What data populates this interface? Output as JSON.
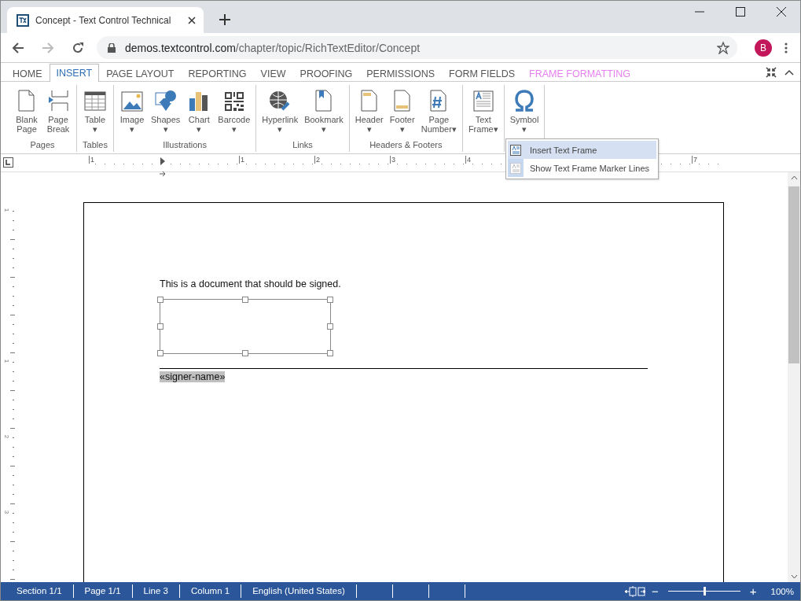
{
  "browser": {
    "tab_title": "Concept - Text Control Technical",
    "url_host": "demos.textcontrol.com",
    "url_path": "/chapter/topic/RichTextEditor/Concept",
    "profile_initial": "B"
  },
  "ribbon_tabs": [
    {
      "label": "HOME",
      "selected": false,
      "kind": "standard"
    },
    {
      "label": "INSERT",
      "selected": true,
      "kind": "standard"
    },
    {
      "label": "PAGE LAYOUT",
      "selected": false,
      "kind": "standard"
    },
    {
      "label": "REPORTING",
      "selected": false,
      "kind": "standard"
    },
    {
      "label": "VIEW",
      "selected": false,
      "kind": "standard"
    },
    {
      "label": "PROOFING",
      "selected": false,
      "kind": "standard"
    },
    {
      "label": "PERMISSIONS",
      "selected": false,
      "kind": "standard"
    },
    {
      "label": "FORM FIELDS",
      "selected": false,
      "kind": "standard"
    },
    {
      "label": "FRAME FORMATTING",
      "selected": false,
      "kind": "contextual"
    }
  ],
  "ribbon_groups": [
    {
      "label": "Pages",
      "buttons": [
        {
          "kind": "blank-page",
          "lines": [
            "Blank",
            "Page"
          ]
        },
        {
          "kind": "page-break",
          "lines": [
            "Page",
            "Break"
          ]
        }
      ]
    },
    {
      "label": "Tables",
      "buttons": [
        {
          "kind": "table",
          "lines": [
            "Table",
            "▾"
          ]
        }
      ]
    },
    {
      "label": "Illustrations",
      "buttons": [
        {
          "kind": "image",
          "lines": [
            "Image",
            "▾"
          ]
        },
        {
          "kind": "shapes",
          "lines": [
            "Shapes",
            "▾"
          ]
        },
        {
          "kind": "chart",
          "lines": [
            "Chart",
            "▾"
          ]
        },
        {
          "kind": "barcode",
          "lines": [
            "Barcode",
            "▾"
          ]
        }
      ]
    },
    {
      "label": "Links",
      "buttons": [
        {
          "kind": "hyperlink",
          "lines": [
            "Hyperlink",
            "▾"
          ]
        },
        {
          "kind": "bookmark",
          "lines": [
            "Bookmark",
            "▾"
          ]
        }
      ]
    },
    {
      "label": "Headers & Footers",
      "buttons": [
        {
          "kind": "header",
          "lines": [
            "Header",
            "▾"
          ]
        },
        {
          "kind": "footer",
          "lines": [
            "Footer",
            "▾"
          ]
        },
        {
          "kind": "page-number",
          "lines": [
            "Page",
            "Number▾"
          ]
        }
      ]
    },
    {
      "buttons": [
        {
          "kind": "text-frame",
          "lines": [
            "Text",
            "Frame▾"
          ]
        }
      ]
    },
    {
      "buttons": [
        {
          "kind": "symbol",
          "lines": [
            "Symbol",
            "▾"
          ]
        }
      ]
    }
  ],
  "dropdown_menu": [
    {
      "label": "Insert Text Frame",
      "selected": true
    },
    {
      "label": "Show Text Frame Marker Lines",
      "selected": false
    }
  ],
  "ruler": {
    "labels": [
      "1",
      "1",
      "2",
      "3",
      "4",
      "7"
    ]
  },
  "vertical_ruler": {
    "labels": [
      "1",
      "1",
      "2",
      "3"
    ]
  },
  "document": {
    "paragraph": "This is a document that should be signed.",
    "text_frame": {
      "selected": true
    },
    "merge_field": "«signer-name»"
  },
  "status_bar": {
    "items": [
      "Section 1/1",
      "Page 1/1",
      "Line 3",
      "Column 1",
      "English (United States)"
    ],
    "zoom": {
      "minus": "−",
      "plus": "+",
      "level": 0.5,
      "value": "100%"
    }
  }
}
